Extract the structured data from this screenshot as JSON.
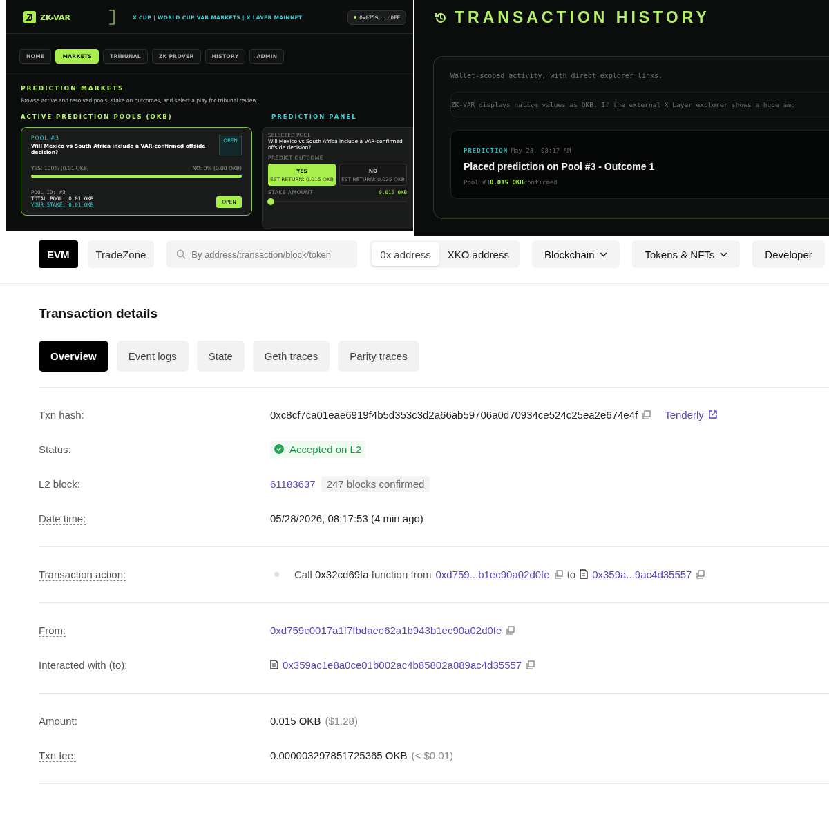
{
  "app_panel": {
    "brand": "ZK-VAR",
    "header_text": "X CUP | WORLD CUP VAR MARKETS | X LAYER MAINNET",
    "wallet": "0x0759...d0FE",
    "nav": [
      {
        "label": "HOME",
        "selected": false
      },
      {
        "label": "MARKETS",
        "selected": true
      },
      {
        "label": "TRIBUNAL",
        "selected": false
      },
      {
        "label": "ZK PROVER",
        "selected": false
      },
      {
        "label": "HISTORY",
        "selected": false
      },
      {
        "label": "ADMIN",
        "selected": false
      }
    ],
    "section_title": "PREDICTION MARKETS",
    "description": "Browse active and resolved pools, stake on outcomes, and select a play for tribunal review.",
    "pools_title": "ACTIVE PREDICTION POOLS (OKB)",
    "pool": {
      "name": "POOL #3",
      "status": "OPEN",
      "question": "Will Mexico vs South Africa include a VAR-confirmed offside decision?",
      "yes_label": "YES: 100% (0.01 OKB)",
      "no_label": "NO: 0% (0.00 OKB)",
      "level": 1,
      "pool_id": "POOL ID: #3",
      "total_pool": "TOTAL POOL: 0.01 OKB",
      "your_stake": "YOUR STAKE: 0.01 OKB",
      "button": "OPEN"
    },
    "panel": {
      "title": "PREDICTION PANEL",
      "selected_label": "SELECTED POOL",
      "question": "Will Mexico vs South Africa include a VAR-confirmed offside decision?",
      "outcome_label": "PREDICT OUTCOME",
      "options": [
        {
          "label": "YES",
          "est": "EST RETURN: 0.015 OKB",
          "selected": true
        },
        {
          "label": "NO",
          "est": "EST RETURN: 0.025 OKB",
          "selected": false
        }
      ],
      "stake_label": "STAKE AMOUNT",
      "stake_value": "0.015 OKB",
      "level": 0
    }
  },
  "history_panel": {
    "title": "TRANSACTION HISTORY",
    "description": "Wallet-scoped activity, with direct explorer links.",
    "notice": "ZK-VAR displays native values as OKB. If the external X Layer explorer shows a huge amo",
    "entry": {
      "type": "PREDICTION",
      "time": "May 28, 08:17 AM",
      "title": "Placed prediction on Pool #3 - Outcome 1",
      "pool": "Pool #3",
      "amount": "0.015 OKB",
      "status": "confirmed"
    }
  },
  "explorer": {
    "network_tabs": [
      {
        "label": "EVM",
        "selected": true
      },
      {
        "label": "TradeZone",
        "selected": false
      }
    ],
    "search": {
      "placeholder": "By address/transaction/block/token"
    },
    "address_toggle": [
      {
        "label": "0x address",
        "selected": true
      },
      {
        "label": "XKO address",
        "selected": false
      }
    ],
    "menus": [
      "Blockchain",
      "Tokens & NFTs",
      "Developer"
    ],
    "title": "Transaction details",
    "tabs": [
      {
        "label": "Overview",
        "selected": true
      },
      {
        "label": "Event logs",
        "selected": false
      },
      {
        "label": "State",
        "selected": false
      },
      {
        "label": "Geth traces",
        "selected": false
      },
      {
        "label": "Parity traces",
        "selected": false
      }
    ],
    "groups": [
      [
        {
          "kind": "hash",
          "label": "Txn hash:",
          "dotted": false,
          "value": "0xc8cf7ca01eae6919f4b5d353c3d2a66ab59706a0d70934ce524c25ea2e674e4f",
          "link": "Tenderly"
        },
        {
          "kind": "status",
          "label": "Status:",
          "dotted": false,
          "badge": "Accepted on L2"
        },
        {
          "kind": "block",
          "label": "L2 block:",
          "dotted": false,
          "link": "61183637",
          "chip": "247 blocks confirmed"
        },
        {
          "kind": "text",
          "label": "Date time:",
          "dotted": true,
          "value": "05/28/2026, 08:17:53 (4 min ago)"
        }
      ],
      [
        {
          "kind": "action",
          "label": "Transaction action:",
          "dotted": true,
          "verb": "Call",
          "method": "0x32cd69fa",
          "from_text": "function from",
          "from_link": "0xd759...b1ec90a02d0fe",
          "to_text": "to",
          "to_link": "0x359a...9ac4d35557"
        }
      ],
      [
        {
          "kind": "address",
          "label": "From:",
          "dotted": true,
          "link": "0xd759c0017a1f7fbdaee62a1b943b1ec90a02d0fe"
        },
        {
          "kind": "contract",
          "label": "Interacted with (to):",
          "dotted": true,
          "link": "0x359ac1e8a0ce01b002ac4b85802a889ac4d35557"
        }
      ],
      [
        {
          "kind": "amount",
          "label": "Amount:",
          "dotted": true,
          "value": "0.015 OKB",
          "note": "($1.28)"
        },
        {
          "kind": "amount",
          "label": "Txn fee:",
          "dotted": true,
          "value": "0.000003297851725365 OKB",
          "note": "(< $0.01)"
        }
      ]
    ]
  }
}
